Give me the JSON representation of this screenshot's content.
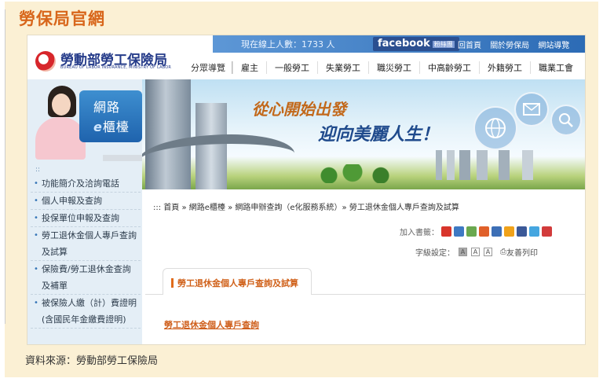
{
  "page_heading": "勞保局官網",
  "source_caption": "資料來源：勞動部勞工保險局",
  "header": {
    "online_count": "現在線上人數：1733 人",
    "facebook": "facebook",
    "facebook_tag": "粉絲團",
    "top_links": [
      "回首頁",
      "關於勞保局",
      "網站導覽"
    ],
    "logo_title": "勞動部勞工保險局",
    "logo_subtitle": "BUREAU OF LABOR INSURANCE, MINISTRY OF LABOR"
  },
  "nav": {
    "guide": "分眾導覽",
    "items": [
      "雇主",
      "一般勞工",
      "失業勞工",
      "職災勞工",
      "中高齡勞工",
      "外籍勞工",
      "職業工會"
    ]
  },
  "banner": {
    "slogan_1": "從心開始出發",
    "slogan_2": "迎向美麗人生！"
  },
  "left_panel": {
    "title_1": "網路",
    "title_2_prefix": "e",
    "title_2_suffix": "櫃檯",
    "dots": "::",
    "menu": [
      "功能簡介及洽詢電話",
      "個人申報及查詢",
      "投保單位申報及查詢",
      "勞工退休金個人專戶查詢",
      "及試算",
      "保險費/勞工退休金查詢",
      "及補單",
      "被保險人繳（計）費證明",
      "(含國民年金繳費證明)"
    ]
  },
  "main": {
    "breadcrumb": ":::  首頁 » 網路e櫃檯 » 網路申辦查詢（e化服務系統）» 勞工退休金個人專戶查詢及試算",
    "bookmark_label": "加入書籤：",
    "bookmark_icon_colors": [
      "#d8352b",
      "#3e79c3",
      "#6aa84f",
      "#e0602a",
      "#3d6fb6",
      "#f0a21a",
      "#3b5998",
      "#45a6e0",
      "#d23b3b"
    ],
    "font_size_label": "字級設定：",
    "font_size_options": [
      "A",
      "A",
      "A"
    ],
    "print_label": "友善列印",
    "tab_title": "勞工退休金個人專戶查詢及試算",
    "link": "勞工退休金個人專戶查詢"
  }
}
